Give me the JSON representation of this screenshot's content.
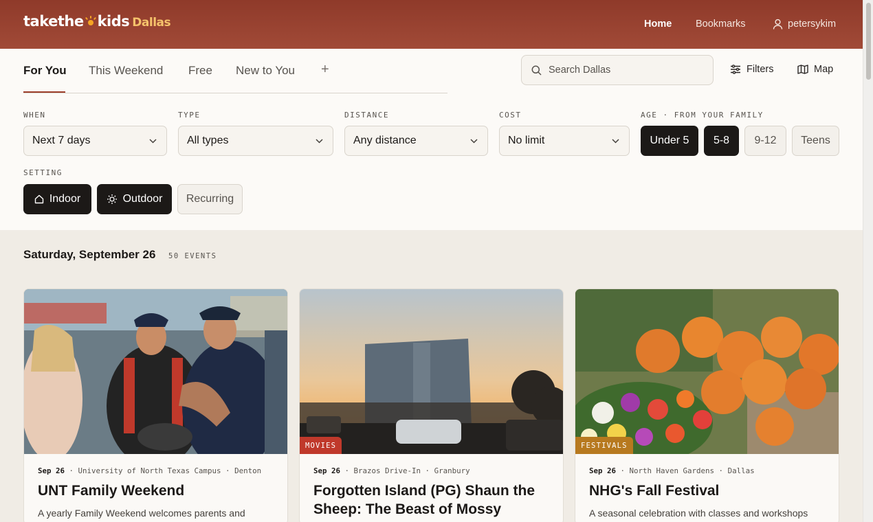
{
  "header": {
    "logo_part1": "takethe",
    "logo_part2": "kids",
    "city": "Dallas",
    "nav": {
      "home": "Home",
      "bookmarks": "Bookmarks",
      "user": "petersykim"
    }
  },
  "tabs": [
    {
      "label": "For You",
      "active": true
    },
    {
      "label": "This Weekend",
      "active": false
    },
    {
      "label": "Free",
      "active": false
    },
    {
      "label": "New to You",
      "active": false
    }
  ],
  "add_tab_label": "+",
  "search": {
    "placeholder": "Search Dallas"
  },
  "toolbar": {
    "filters_label": "Filters",
    "map_label": "Map"
  },
  "filters": {
    "when": {
      "label": "WHEN",
      "value": "Next 7 days"
    },
    "type": {
      "label": "TYPE",
      "value": "All types"
    },
    "distance": {
      "label": "DISTANCE",
      "value": "Any distance"
    },
    "cost": {
      "label": "COST",
      "value": "No limit"
    },
    "age": {
      "label": "AGE · FROM YOUR FAMILY",
      "options": [
        {
          "label": "Under 5",
          "selected": true
        },
        {
          "label": "5-8",
          "selected": true
        },
        {
          "label": "9-12",
          "selected": false
        },
        {
          "label": "Teens",
          "selected": false
        }
      ]
    },
    "setting": {
      "label": "SETTING",
      "options": [
        {
          "label": "Indoor",
          "selected": true,
          "icon": "home-icon"
        },
        {
          "label": "Outdoor",
          "selected": true,
          "icon": "sun-icon"
        },
        {
          "label": "Recurring",
          "selected": false
        }
      ]
    }
  },
  "results": {
    "date": "Saturday, September 26",
    "count": "50 EVENTS"
  },
  "events": [
    {
      "date": "Sep 26",
      "venue": "University of North Texas Campus",
      "city": "Denton",
      "title": "UNT Family Weekend",
      "description": "A yearly Family Weekend welcomes parents and",
      "badge": null
    },
    {
      "date": "Sep 26",
      "venue": "Brazos Drive-In",
      "city": "Granbury",
      "title": "Forgotten Island (PG) Shaun the Sheep: The Beast of Mossy Botto...",
      "description": "",
      "badge": "MOVIES",
      "badge_color": "#c0392b"
    },
    {
      "date": "Sep 26",
      "venue": "North Haven Gardens",
      "city": "Dallas",
      "title": "NHG's Fall Festival",
      "description": "A seasonal celebration with classes and workshops",
      "badge": "FESTIVALS",
      "badge_color": "#b7791f"
    }
  ],
  "colors": {
    "header": "#9c3d2a",
    "accent": "#f5a524",
    "selected_pill": "#1c1917"
  }
}
